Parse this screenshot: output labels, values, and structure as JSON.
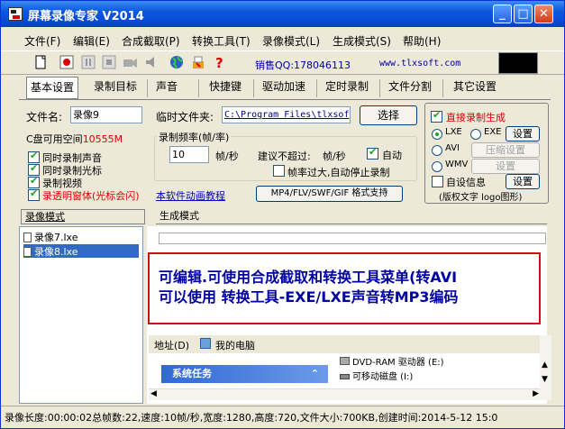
{
  "window": {
    "title": "屏幕录像专家 V2014"
  },
  "menu": [
    "文件(F)",
    "编辑(E)",
    "合成截取(P)",
    "转换工具(T)",
    "录像模式(L)",
    "生成模式(S)",
    "帮助(H)"
  ],
  "toolbar": {
    "qq": "销售QQ:178046113",
    "site": "www.tlxsoft.com"
  },
  "tabs": [
    "基本设置",
    "录制目标",
    "声音",
    "快捷键",
    "驱动加速",
    "定时录制",
    "文件分割",
    "其它设置"
  ],
  "form": {
    "filename_label": "文件名:",
    "filename_value": "录像9",
    "temp_label": "临时文件夹:",
    "temp_value": "C:\\Program Files\\tlxsof",
    "browse_btn": "选择",
    "disk_label": "C盘可用空间",
    "disk_value": "10555M",
    "freq_group": "录制频率(帧/率)",
    "fps_value": "10",
    "fps_unit": "帧/秒",
    "suggest": "建议不超过:",
    "suggest_unit": "帧/秒",
    "auto": "自动",
    "auto_stop": "帧率过大,自动停止录制",
    "chk_sound": "同时录制声音",
    "chk_cursor": "同时录制光标",
    "chk_video": "录制视频",
    "chk_transparent": "录透明窗体(光标会闪)",
    "tutorial_link": "本软件动画教程",
    "format_btn": "MP4/FLV/SWF/GIF 格式支持",
    "direct_gen": "直接录制生成",
    "lxe": "LXE",
    "exe": "EXE",
    "settings1": "设置",
    "avi": "AVI",
    "compress": "压缩设置",
    "wmv": "WMV",
    "settings2": "设置",
    "custom_info": "自设信息",
    "settings3": "设置",
    "copyright_note": "(版权文字 logo图形)"
  },
  "lower": {
    "tab_record": "录像模式",
    "tab_generate": "生成模式",
    "items": [
      "录像7.lxe",
      "录像8.lxe"
    ],
    "line1": "可编辑.可使用合成截取和转换工具菜单(转AVI",
    "line2": "可以使用 转换工具-EXE/LXE声音转MP3编码",
    "addr_label": "地址(D)",
    "addr_value": "我的电脑",
    "sys_task": "系统任务",
    "drive1": "DVD-RAM 驱动器 (E:)",
    "drive2": "可移动磁盘 (I:)"
  },
  "status": "录像长度:00:00:02总帧数:22,速度:10帧/秒,宽度:1280,高度:720,文件大小:700KB,创建时间:2014-5-12 15:0"
}
